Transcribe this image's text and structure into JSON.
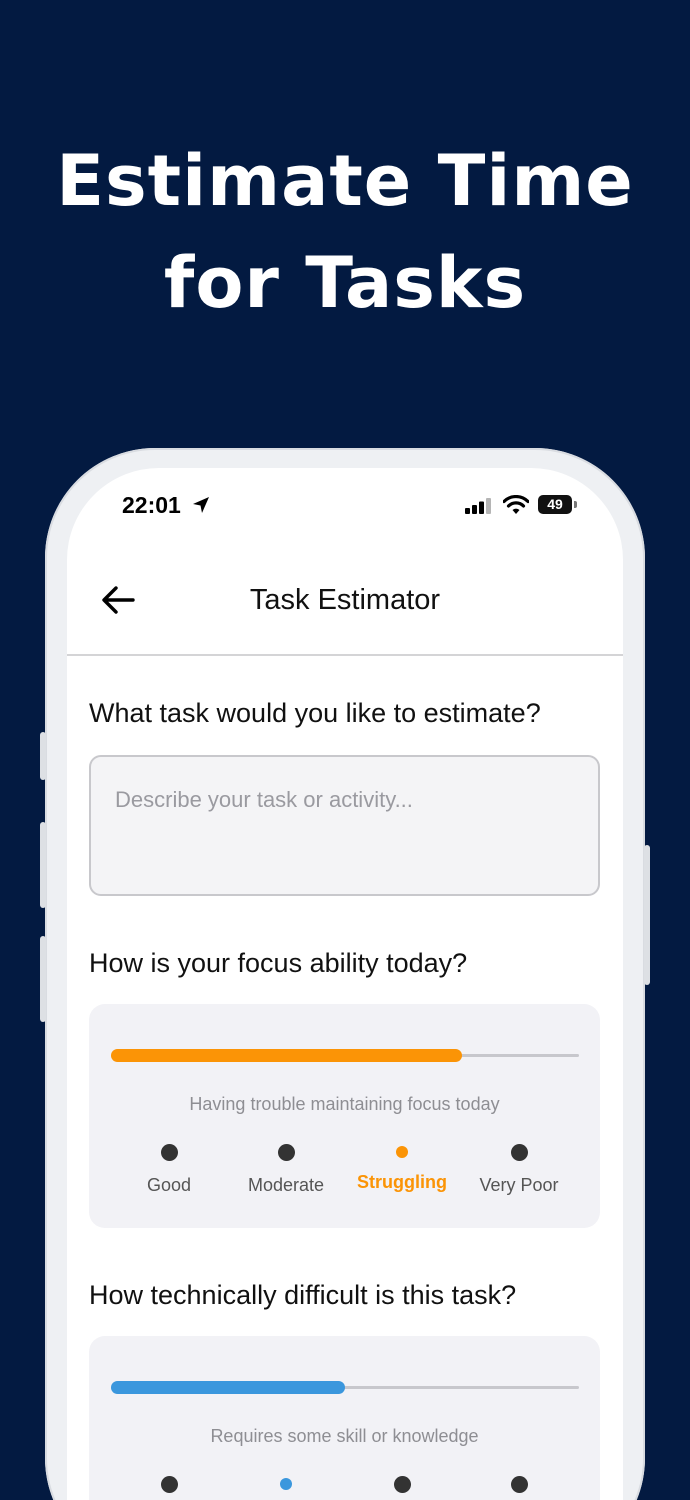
{
  "promo": {
    "headline_line1": "Estimate Time",
    "headline_line2": "for Tasks"
  },
  "status_bar": {
    "time": "22:01",
    "battery": "49",
    "icons": [
      "location-arrow-icon",
      "signal-icon",
      "wifi-icon",
      "battery-icon"
    ]
  },
  "nav": {
    "back_icon": "arrow-left-icon",
    "title": "Task Estimator"
  },
  "task": {
    "question": "What task would you like to estimate?",
    "placeholder": "Describe your task or activity...",
    "value": ""
  },
  "focus": {
    "question": "How is your focus ability today?",
    "description": "Having trouble maintaining focus today",
    "progress": 0.75,
    "accent": "#fb9406",
    "options": [
      "Good",
      "Moderate",
      "Struggling",
      "Very Poor"
    ],
    "selected": "Struggling"
  },
  "difficulty": {
    "question": "How technically difficult is this task?",
    "description": "Requires some skill or knowledge",
    "progress": 0.5,
    "accent": "#3b97dd",
    "selected_index": 1
  },
  "colors": {
    "background": "#031a41",
    "text_dark": "#111111",
    "muted": "#8e8e93"
  }
}
